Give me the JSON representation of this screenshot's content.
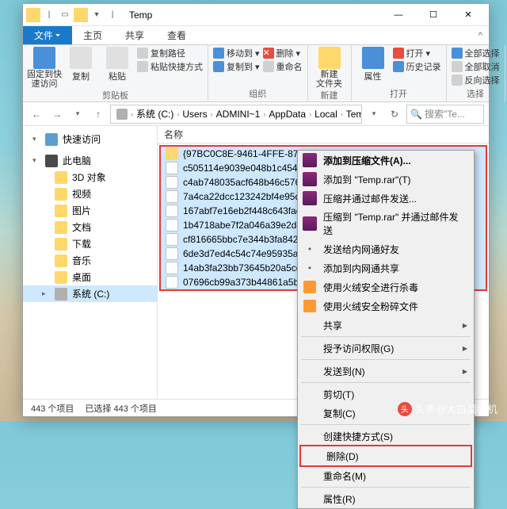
{
  "title": "Temp",
  "tabs": {
    "file": "文件",
    "home": "主页",
    "share": "共享",
    "view": "查看"
  },
  "ribbon": {
    "pin": "固定到快\n速访问",
    "copy": "复制",
    "paste": "粘贴",
    "copypath": "复制路径",
    "pasteshortcut": "粘贴快捷方式",
    "clipboard_grp": "剪贴板",
    "moveto": "移动到",
    "copyto": "复制到",
    "delete": "删除",
    "rename": "重命名",
    "organize_grp": "组织",
    "newfolder": "新建\n文件夹",
    "new_grp": "新建",
    "properties": "属性",
    "open": "打开",
    "history": "历史记录",
    "open_grp": "打开",
    "selectall": "全部选择",
    "selectnone": "全部取消",
    "invertsel": "反向选择",
    "select_grp": "选择"
  },
  "breadcrumb": [
    "系统 (C:)",
    "Users",
    "ADMINI~1",
    "AppData",
    "Local",
    "Temp"
  ],
  "refresh_hint": "↻",
  "search_placeholder": "搜索\"Te...",
  "nav": {
    "quick": "快速访问",
    "thispc": "此电脑",
    "items": [
      "3D 对象",
      "视频",
      "图片",
      "文档",
      "下载",
      "音乐",
      "桌面",
      "系统 (C:)"
    ]
  },
  "col_name": "名称",
  "files": [
    {
      "t": "folder",
      "n": "{97BC0C8E-9461-4FFE-87B5-1"
    },
    {
      "t": "file",
      "n": "c505114e9039e048b1c454063"
    },
    {
      "t": "file",
      "n": "c4ab748035acf648b46c57675"
    },
    {
      "t": "file",
      "n": "7a4ca22dcc123242bf4e95d18"
    },
    {
      "t": "file",
      "n": "167abf7e16eb2f448c643faee0"
    },
    {
      "t": "file",
      "n": "1b4718abe7f2a046a39e2d4c0"
    },
    {
      "t": "file",
      "n": "cf816665bbc7e344b3fa842c1c"
    },
    {
      "t": "file",
      "n": "6de3d7ed4c54c74e95935a23c"
    },
    {
      "t": "file",
      "n": "14ab3fa23bb73645b20a5cd12"
    },
    {
      "t": "file",
      "n": "07696cb99a373b44861a5b0d"
    }
  ],
  "status": {
    "count": "443 个项目",
    "selected": "已选择 443 个项目"
  },
  "context": [
    {
      "ico": "rar",
      "label": "添加到压缩文件(A)...",
      "bold": true
    },
    {
      "ico": "rar",
      "label": "添加到 \"Temp.rar\"(T)"
    },
    {
      "ico": "rar",
      "label": "压缩并通过邮件发送..."
    },
    {
      "ico": "rar",
      "label": "压缩到 \"Temp.rar\" 并通过邮件发送"
    },
    {
      "ico": "shield",
      "label": "发送给内网通好友"
    },
    {
      "ico": "shield",
      "label": "添加到内网通共享"
    },
    {
      "ico": "green",
      "label": "使用火绒安全进行杀毒"
    },
    {
      "ico": "green",
      "label": "使用火绒安全粉碎文件"
    },
    {
      "ico": "",
      "label": "共享",
      "sub": true
    },
    {
      "sep": true
    },
    {
      "ico": "",
      "label": "授予访问权限(G)",
      "sub": true
    },
    {
      "sep": true
    },
    {
      "ico": "",
      "label": "发送到(N)",
      "sub": true
    },
    {
      "sep": true
    },
    {
      "ico": "",
      "label": "剪切(T)"
    },
    {
      "ico": "",
      "label": "复制(C)"
    },
    {
      "sep": true
    },
    {
      "ico": "",
      "label": "创建快捷方式(S)"
    },
    {
      "ico": "",
      "label": "删除(D)",
      "hl": true
    },
    {
      "ico": "",
      "label": "重命名(M)"
    },
    {
      "sep": true
    },
    {
      "ico": "",
      "label": "属性(R)"
    }
  ],
  "watermark": "头条@大白菜装机"
}
